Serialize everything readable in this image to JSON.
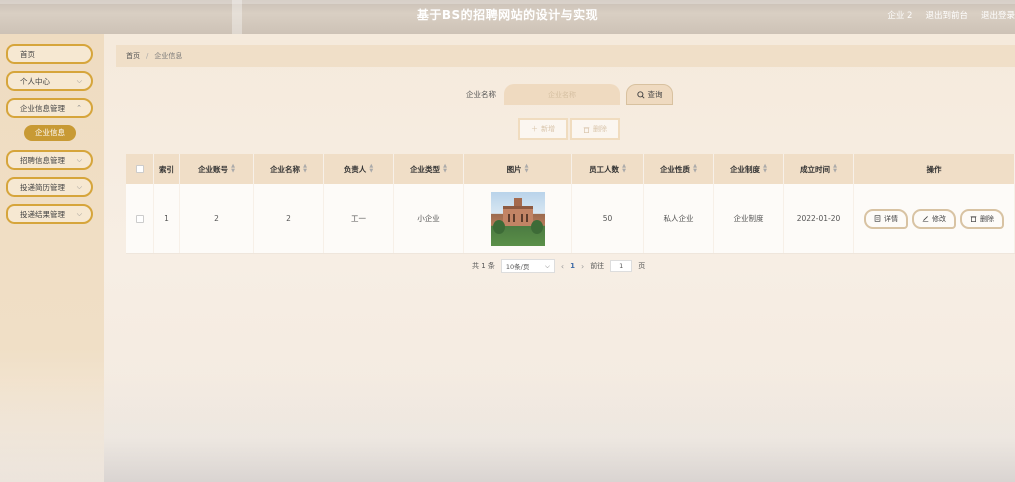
{
  "header": {
    "title": "基于BS的招聘网站的设计与实现",
    "user": "企业 2",
    "exit_to_frontend": "退出到前台",
    "logout": "退出登录"
  },
  "sidebar": {
    "items": [
      {
        "label": "首页"
      },
      {
        "label": "个人中心"
      },
      {
        "label": "企业信息管理"
      },
      {
        "label": "招聘信息管理"
      },
      {
        "label": "投递简历管理"
      },
      {
        "label": "投递结果管理"
      }
    ],
    "sub_active": "企业信息"
  },
  "breadcrumb": {
    "home": "首页",
    "current": "企业信息"
  },
  "search": {
    "label": "企业名称",
    "placeholder": "企业名称",
    "button": "查询"
  },
  "actions": {
    "add": "新增",
    "delete": "删除"
  },
  "table": {
    "headers": [
      "索引",
      "企业账号",
      "企业名称",
      "负责人",
      "企业类型",
      "图片",
      "员工人数",
      "企业性质",
      "企业制度",
      "成立时间",
      "操作"
    ],
    "rows": [
      {
        "index": "1",
        "account": "2",
        "name": "2",
        "manager": "工一",
        "type": "小企业",
        "staff": "50",
        "nature": "私人企业",
        "system": "企业制度",
        "founded": "2022-01-20",
        "ops": {
          "detail": "详情",
          "edit": "修改",
          "delete": "删除"
        }
      }
    ]
  },
  "pagination": {
    "total": "共 1 条",
    "page_size": "10条/页",
    "current": "1",
    "goto_label": "前往",
    "goto_value": "1",
    "page_unit": "页"
  },
  "colors": {
    "accent": "#d6a53b",
    "active_sub": "#c89a34",
    "header_bg": "#f0dec7",
    "link_blue": "#3f6aa5"
  }
}
